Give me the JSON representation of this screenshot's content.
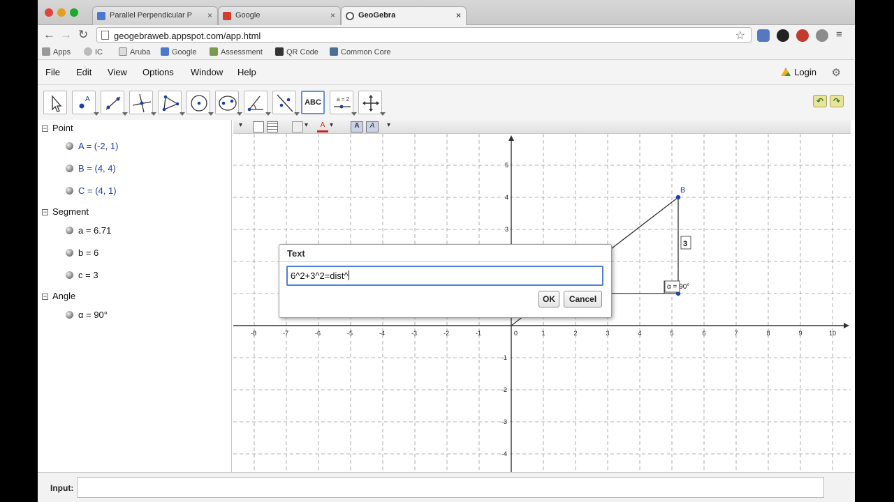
{
  "browser": {
    "tabs": [
      {
        "label": "Parallel Perpendicular P",
        "active": false,
        "color": "#4a78d0"
      },
      {
        "label": "Google",
        "active": false,
        "color": "#d33c2f"
      },
      {
        "label": "GeoGebra",
        "active": true,
        "color": "#5a5a5a"
      }
    ],
    "url": "geogebraweb.appspot.com/app.html",
    "bookmarks": [
      "Apps",
      "IC",
      "Aruba",
      "Google",
      "Assessment",
      "QR Code",
      "Common Core"
    ]
  },
  "menu": {
    "items": [
      "File",
      "Edit",
      "View",
      "Options",
      "Window",
      "Help"
    ],
    "login": "Login"
  },
  "tools": {
    "text_tool": "ABC",
    "slider_tool": "a = 2"
  },
  "algebra": {
    "categories": [
      {
        "name": "Point",
        "items": [
          "A = (-2, 1)",
          "B = (4, 4)",
          "C = (4, 1)"
        ]
      },
      {
        "name": "Segment",
        "items": [
          "a = 6.71",
          "b = 6",
          "c = 3"
        ]
      },
      {
        "name": "Angle",
        "items": [
          "α = 90°"
        ]
      }
    ]
  },
  "graphics": {
    "x_ticks": [
      "-8",
      "-7",
      "-6",
      "-5",
      "-4",
      "-3",
      "-2",
      "-1",
      "0",
      "1",
      "2",
      "3",
      "4",
      "5",
      "6",
      "7",
      "8",
      "9",
      "10"
    ],
    "y_ticks": [
      "5",
      "4",
      "3",
      "2",
      "1",
      "-1",
      "-2",
      "-3",
      "-4"
    ],
    "point_b_label": "B",
    "segment_c_label": "3",
    "angle_label": "α = 90°"
  },
  "dialog": {
    "title": "Text",
    "value": "6^2+3^2=dist^",
    "ok_label": "OK",
    "cancel_label": "Cancel"
  },
  "input_bar": {
    "label": "Input:"
  }
}
